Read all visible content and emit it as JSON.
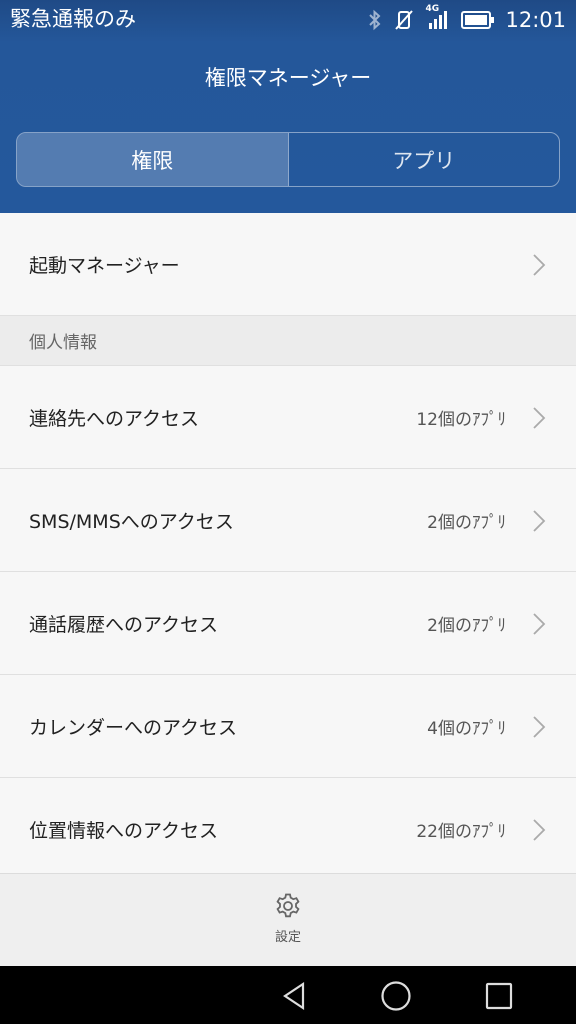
{
  "status_bar": {
    "carrier": "緊急通報のみ",
    "network": "4G",
    "time": "12:01"
  },
  "header": {
    "title": "権限マネージャー",
    "tabs": [
      {
        "label": "権限",
        "active": true
      },
      {
        "label": "アプリ",
        "active": false
      }
    ]
  },
  "list": {
    "startup": {
      "label": "起動マネージャー"
    },
    "section_personal": "個人情報",
    "items": [
      {
        "label": "連絡先へのアクセス",
        "value": "12個のｱﾌﾟﾘ"
      },
      {
        "label": "SMS/MMSへのアクセス",
        "value": "2個のｱﾌﾟﾘ"
      },
      {
        "label": "通話履歴へのアクセス",
        "value": "2個のｱﾌﾟﾘ"
      },
      {
        "label": "カレンダーへのアクセス",
        "value": "4個のｱﾌﾟﾘ"
      },
      {
        "label": "位置情報へのアクセス",
        "value": "22個のｱﾌﾟﾘ"
      }
    ]
  },
  "bottom": {
    "settings_label": "設定",
    "settings_icon": "gear-icon"
  },
  "colors": {
    "header": "#24589c",
    "background": "#f7f7f7"
  }
}
